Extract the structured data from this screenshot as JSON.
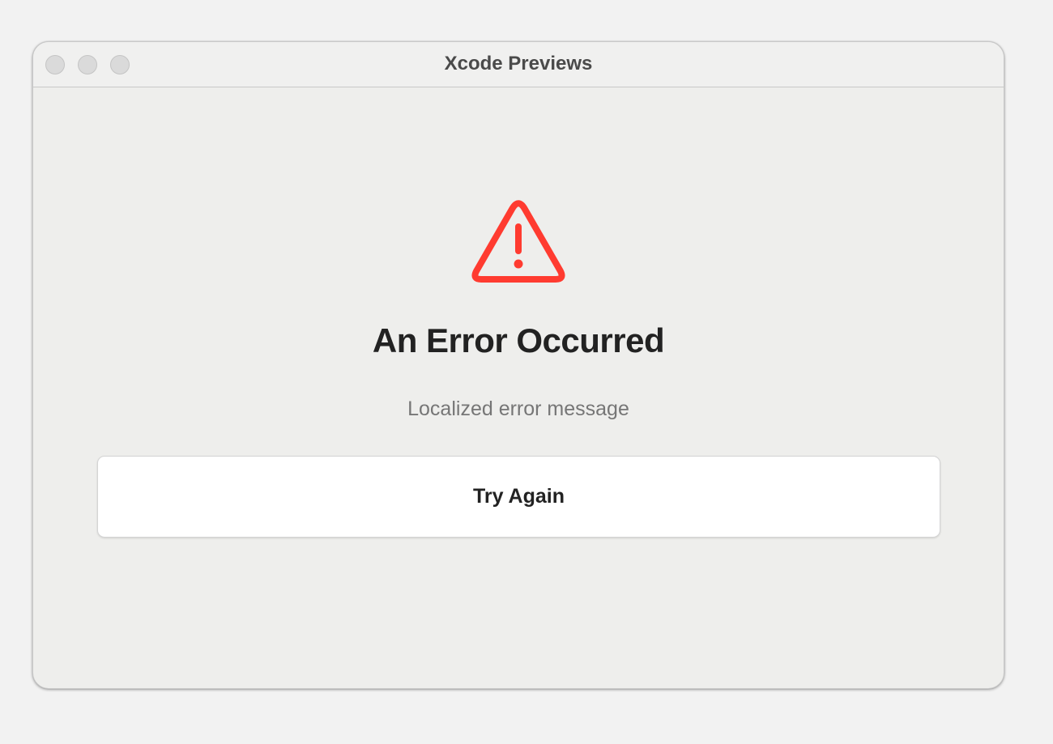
{
  "window": {
    "title": "Xcode Previews"
  },
  "error": {
    "icon": "exclamationmark-triangle-icon",
    "icon_color": "#ff3b30",
    "title": "An Error Occurred",
    "message": "Localized error message"
  },
  "actions": {
    "try_again_label": "Try Again"
  }
}
